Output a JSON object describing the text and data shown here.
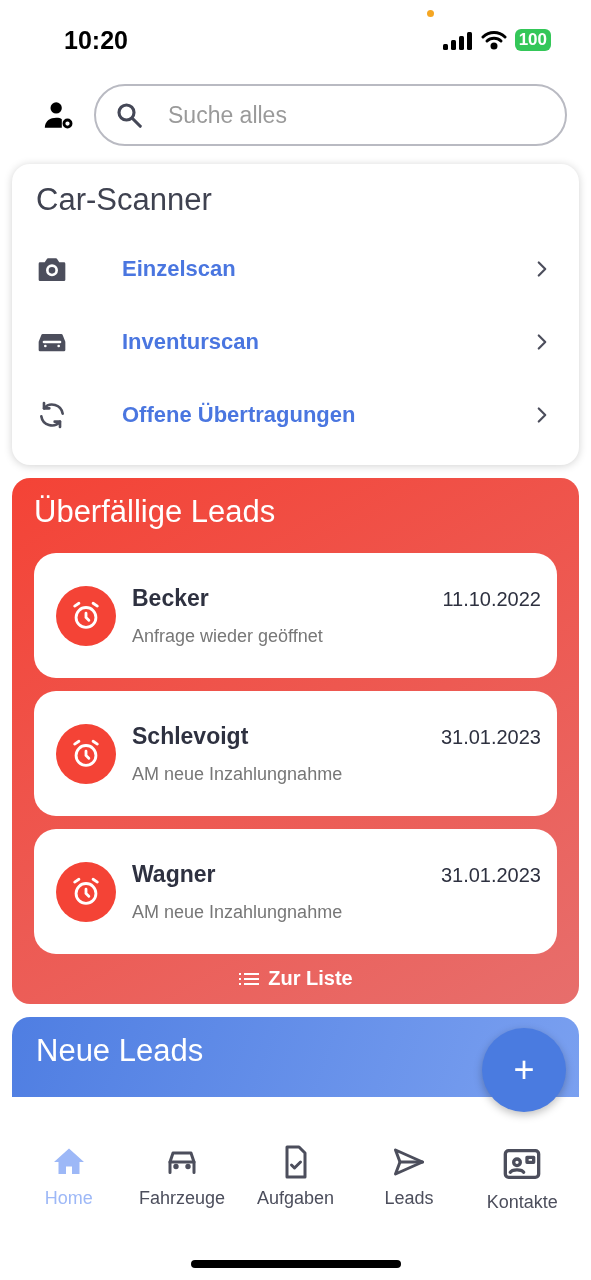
{
  "status_bar": {
    "time": "10:20",
    "battery": "100"
  },
  "search": {
    "placeholder": "Suche alles"
  },
  "scanner": {
    "title": "Car-Scanner",
    "items": [
      {
        "label": "Einzelscan"
      },
      {
        "label": "Inventurscan"
      },
      {
        "label": "Offene Übertragungen"
      }
    ]
  },
  "overdue": {
    "title": "Überfällige Leads",
    "leads": [
      {
        "name": "Becker",
        "date": "11.10.2022",
        "note": "Anfrage wieder geöffnet"
      },
      {
        "name": "Schlevoigt",
        "date": "31.01.2023",
        "note": "AM neue Inzahlungnahme"
      },
      {
        "name": "Wagner",
        "date": "31.01.2023",
        "note": "AM neue Inzahlungnahme"
      }
    ],
    "list_link": "Zur Liste"
  },
  "new_leads": {
    "title": "Neue Leads"
  },
  "fab": "+",
  "nav": [
    {
      "label": "Home",
      "selected": true
    },
    {
      "label": "Fahrzeuge",
      "selected": false
    },
    {
      "label": "Aufgaben",
      "selected": false
    },
    {
      "label": "Leads",
      "selected": false
    },
    {
      "label": "Kontakte",
      "selected": false
    }
  ]
}
